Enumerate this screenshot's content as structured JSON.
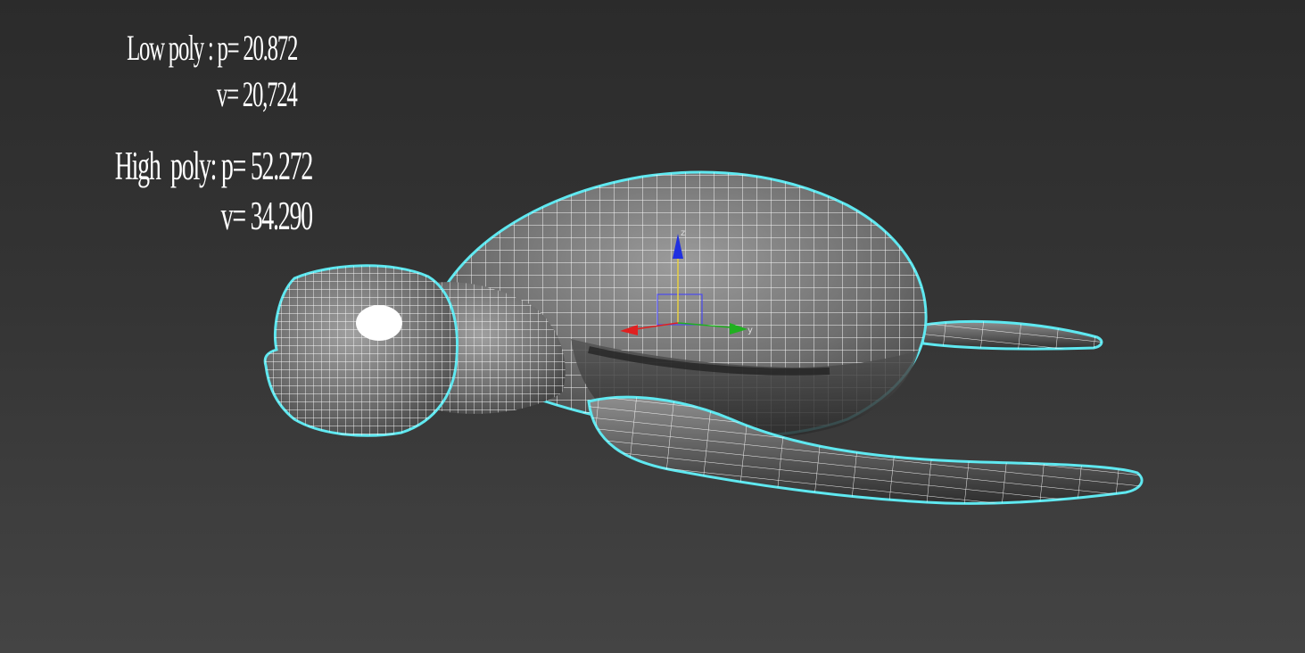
{
  "stats": {
    "low_poly_label": "Low poly : p= 20.872",
    "low_poly_v": "v= 20,724",
    "high_poly_label": "High  poly: p= 52.272",
    "high_poly_v": "v= 34.290"
  },
  "gizmo": {
    "z_label": "z",
    "y_label": "y",
    "x_color": "#e02020",
    "y_color": "#20b020",
    "z_color": "#2030e0"
  },
  "colors": {
    "selection_outline": "#5fe8f0",
    "wire": "#ffffff",
    "mesh_dark": "#3a3a3a",
    "mesh_light": "#9a9a9a"
  }
}
